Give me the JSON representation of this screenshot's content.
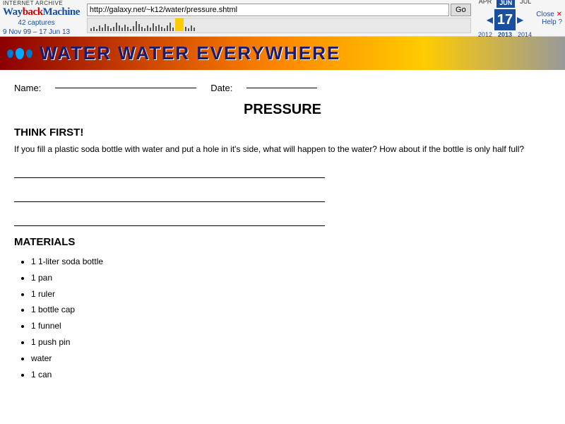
{
  "wayback": {
    "internet_archive_label": "INTERNET ARCHIVE",
    "logo_text": "WaybackMachine",
    "captures_line1": "42 captures",
    "captures_line2": "9 Nov 99 – 17 Jun 13",
    "url": "http://galaxy.net/~k12/water/pressure.shtml",
    "go_label": "Go",
    "months": [
      "APR",
      "JUN",
      "JUL"
    ],
    "active_month": "JUN",
    "day": "17",
    "year_left": "2012",
    "year_right": "2014",
    "year_active": "2013",
    "close_label": "Close",
    "close_x": "✕",
    "help_label": "Help ?",
    "nav_up": "▶",
    "nav_down": "◀"
  },
  "header": {
    "title": "WATER WATER EVERYWHERE"
  },
  "page": {
    "name_label": "Name:",
    "date_label": "Date:",
    "section_title": "PRESSURE",
    "think_first_heading": "THINK FIRST!",
    "think_first_text": "If you fill a plastic soda bottle with water and put a hole in it's side, what will happen to the water? How about if the bottle is only half full?",
    "materials_heading": "MATERIALS",
    "materials": [
      "1 1-liter soda bottle",
      "1 pan",
      "1 ruler",
      "1 bottle cap",
      "1 funnel",
      "1 push pin",
      "water",
      "1 can"
    ]
  }
}
